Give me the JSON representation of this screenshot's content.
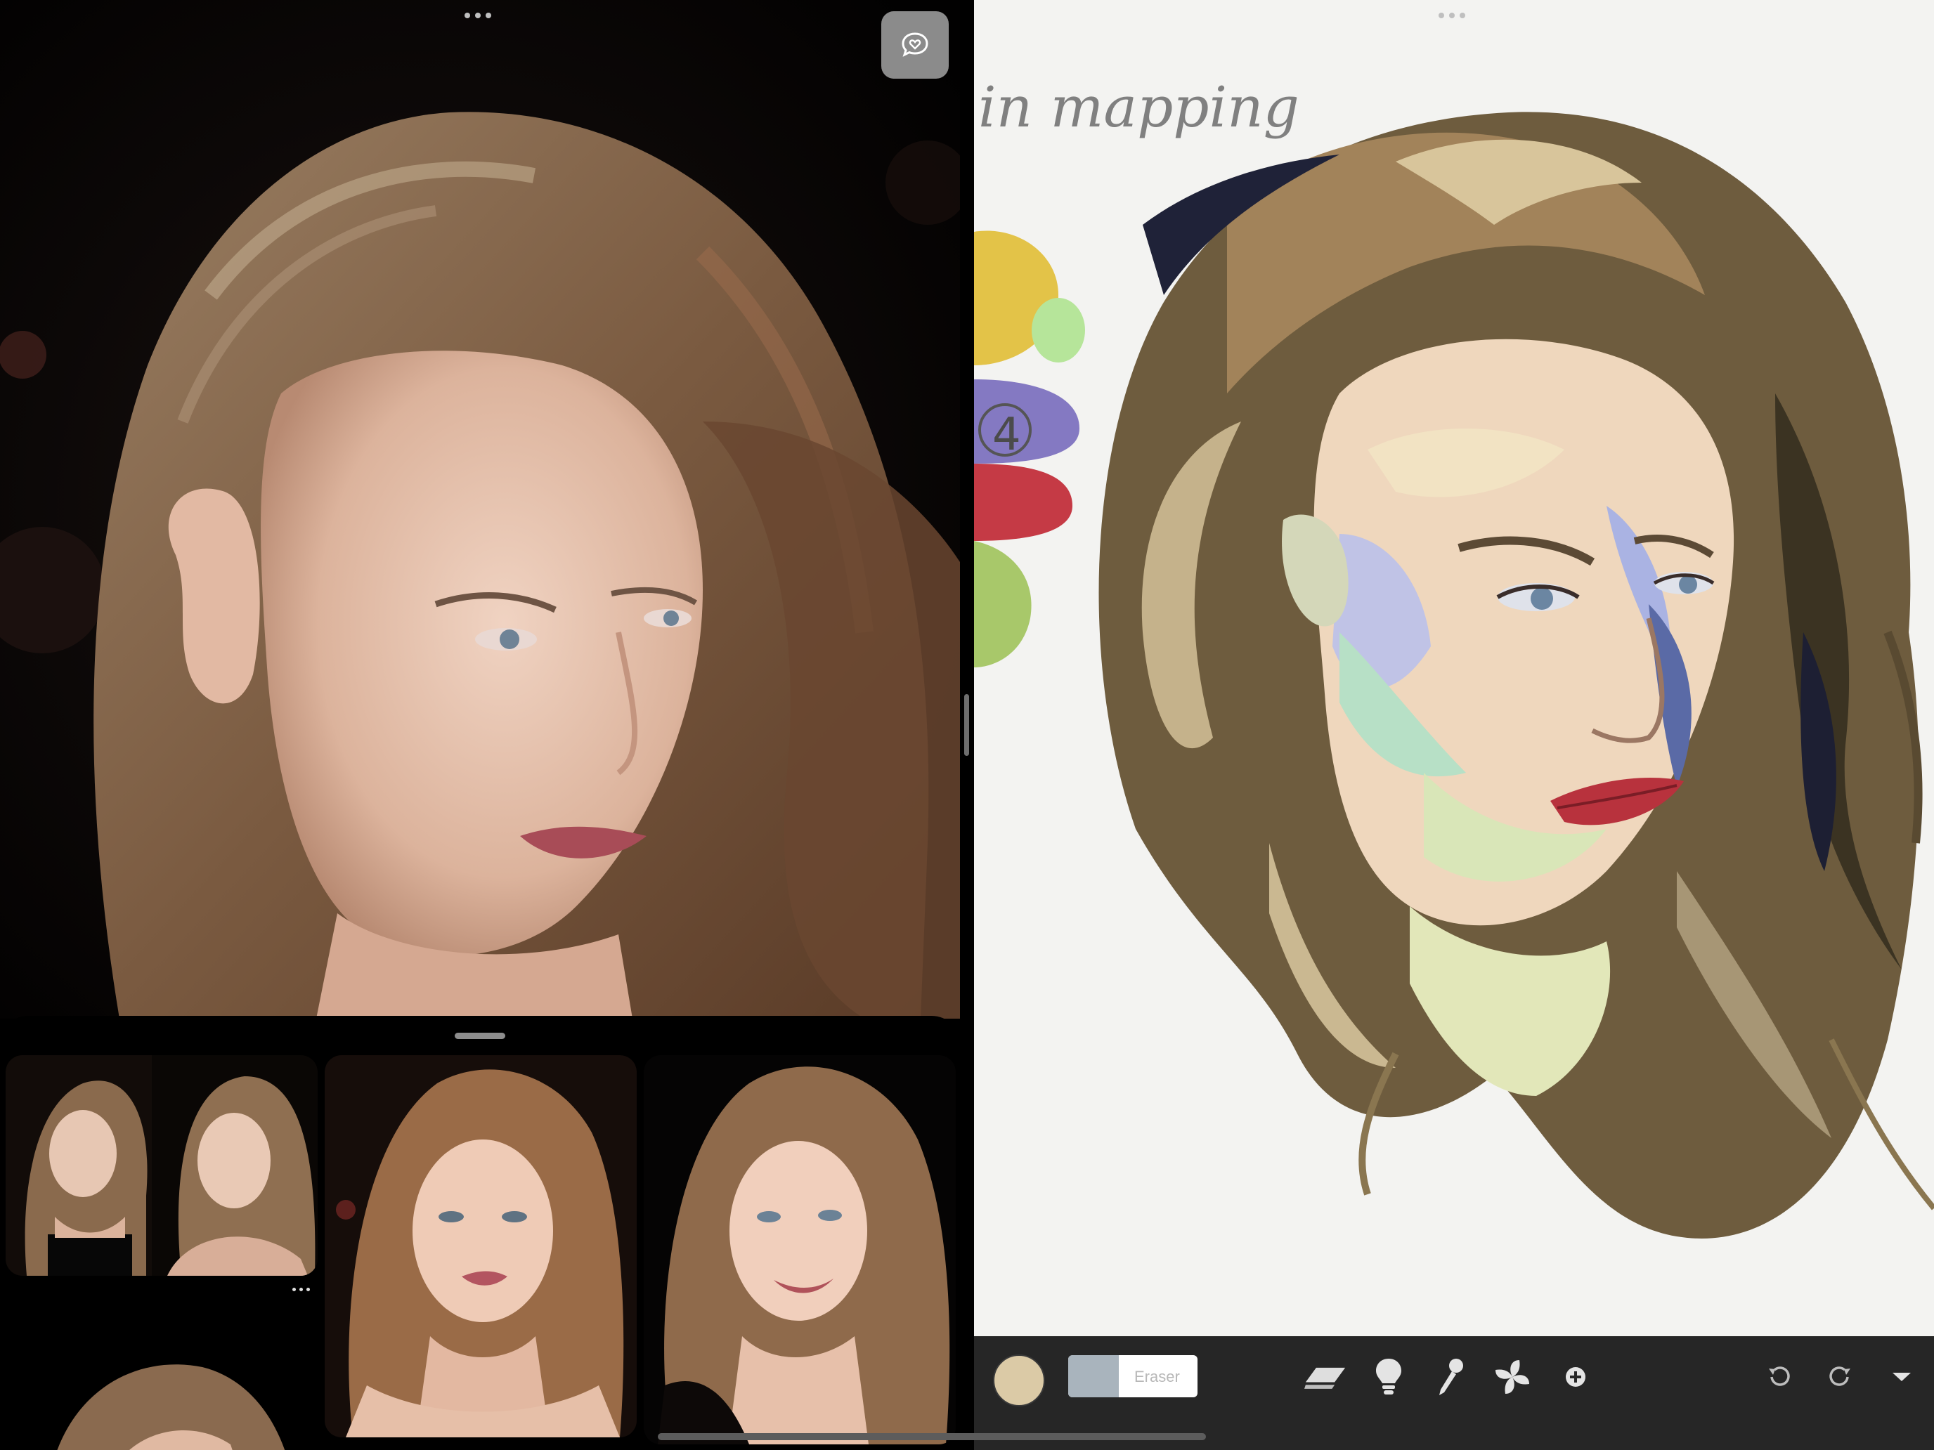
{
  "left_pane": {
    "photo": {
      "subject": "reference-portrait-photo"
    }
  },
  "photos_sheet": {
    "thumbnails": [
      {
        "name": "thumb-collage"
      },
      {
        "name": "thumb-portrait-front"
      },
      {
        "name": "thumb-portrait-smile"
      },
      {
        "name": "thumb-hair-partial"
      }
    ]
  },
  "right_pane": {
    "canvas_text": "in mapping",
    "toolbar": {
      "brush_label": "Eraser",
      "current_color": "#dbcaa6",
      "brush_swatch_color": "#a9b4bd",
      "tools": [
        "layers-icon",
        "lightbulb-icon",
        "eyedropper-icon",
        "pinwheel-icon",
        "add-icon"
      ],
      "history": [
        "undo-icon",
        "redo-icon",
        "dropdown-caret-icon"
      ]
    }
  },
  "colors": {
    "toolbar_bg": "#262626",
    "canvas_bg": "#f3f3f1",
    "hair": "#7b6446",
    "skin": "#e8c8b0"
  }
}
